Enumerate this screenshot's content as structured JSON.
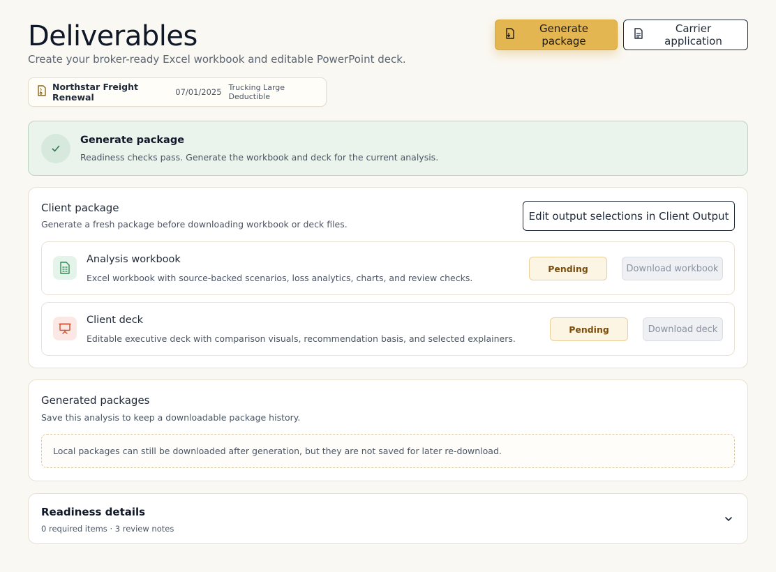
{
  "header": {
    "title": "Deliverables",
    "subtitle": "Create your broker-ready Excel workbook and editable PowerPoint deck."
  },
  "actions": {
    "generate_label": "Generate package",
    "carrier_label": "Carrier application"
  },
  "case": {
    "name": "Northstar Freight Renewal",
    "date": "07/01/2025",
    "program": "Trucking Large Deductible"
  },
  "banner": {
    "title": "Generate package",
    "text": "Readiness checks pass. Generate the workbook and deck for the current analysis."
  },
  "client_package": {
    "title": "Client package",
    "subtitle": "Generate a fresh package before downloading workbook or deck files.",
    "edit_label": "Edit output selections in Client Output",
    "items": [
      {
        "title": "Analysis workbook",
        "description": "Excel workbook with source-backed scenarios, loss analytics, charts, and review checks.",
        "status": "Pending",
        "download_label": "Download workbook",
        "icon": "spreadsheet-icon"
      },
      {
        "title": "Client deck",
        "description": "Editable executive deck with comparison visuals, recommendation basis, and selected explainers.",
        "status": "Pending",
        "download_label": "Download deck",
        "icon": "presentation-icon"
      }
    ]
  },
  "generated": {
    "title": "Generated packages",
    "subtitle": "Save this analysis to keep a downloadable package history.",
    "notice": "Local packages can still be downloaded after generation, but they are not saved for later re-download."
  },
  "readiness": {
    "title": "Readiness details",
    "summary": "0 required items · 3 review notes"
  },
  "colors": {
    "accent": "#e3b652",
    "success_bg": "#eaf4ed",
    "pending": "#7a4e0c"
  }
}
